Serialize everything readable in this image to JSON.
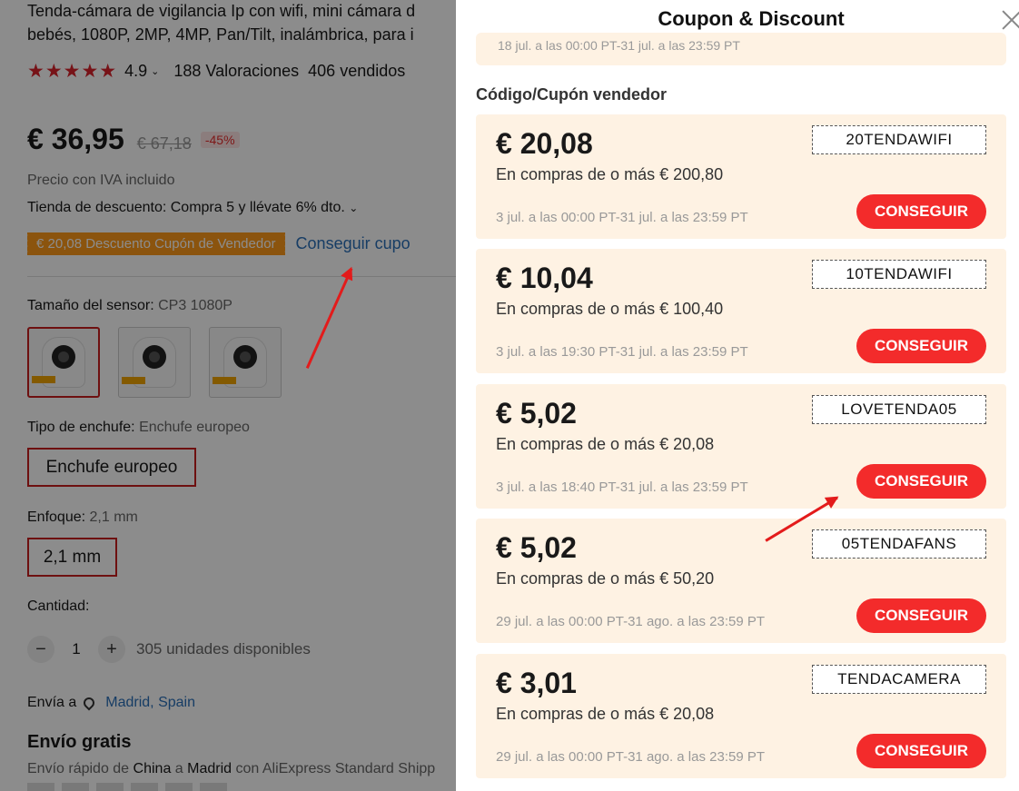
{
  "product": {
    "title_line1": "Tenda-cámara de vigilancia Ip con wifi, mini cámara d",
    "title_line2": "bebés, 1080P, 2MP, 4MP, Pan/Tilt, inalámbrica, para i",
    "stars": "★★★★★",
    "rating": "4.9",
    "reviews": "188 Valoraciones",
    "sold": "406 vendidos",
    "price": "€ 36,95",
    "old_price": "€ 67,18",
    "discount_pct": "-45%",
    "vat_note": "Precio con IVA incluido",
    "store_discount": "Tienda de descuento: Compra 5 y llévate 6% dto.",
    "coupon_tag": "€ 20,08 Descuento Cupón de Vendedor",
    "coupon_link": "Conseguir cupo",
    "sensor_label": "Tamaño del sensor:",
    "sensor_value": "CP3 1080P",
    "plug_label": "Tipo de enchufe:",
    "plug_value": "Enchufe europeo",
    "plug_option": "Enchufe europeo",
    "focus_label": "Enfoque:",
    "focus_value": "2,1 mm",
    "focus_option": "2,1 mm",
    "qty_label": "Cantidad:",
    "qty_minus": "−",
    "qty_value": "1",
    "qty_plus": "+",
    "qty_available": "305 unidades disponibles",
    "ship_to_label": "Envía a",
    "ship_to_location": "Madrid, Spain",
    "free_shipping": "Envío gratis",
    "ship_desc_1": "Envío rápido de ",
    "ship_origin": "China",
    "ship_desc_2": " a ",
    "ship_dest": "Madrid",
    "ship_desc_3": " con AliExpress Standard Shipp"
  },
  "panel": {
    "title": "Coupon & Discount",
    "prev_period": "18 jul. a las 00:00 PT-31 jul. a las 23:59 PT",
    "section_title": "Código/Cupón vendedor",
    "button_label": "CONSEGUIR",
    "coupons": [
      {
        "amount": "€ 20,08",
        "condition": "En compras de o más € 200,80",
        "period": "3 jul. a las 00:00 PT-31 jul. a las 23:59 PT",
        "code": "20TENDAWIFI"
      },
      {
        "amount": "€ 10,04",
        "condition": "En compras de o más € 100,40",
        "period": "3 jul. a las 19:30 PT-31 jul. a las 23:59 PT",
        "code": "10TENDAWIFI"
      },
      {
        "amount": "€ 5,02",
        "condition": "En compras de o más € 20,08",
        "period": "3 jul. a las 18:40 PT-31 jul. a las 23:59 PT",
        "code": "LOVETENDA05"
      },
      {
        "amount": "€ 5,02",
        "condition": "En compras de o más € 50,20",
        "period": "29 jul. a las 00:00 PT-31 ago. a las 23:59 PT",
        "code": "05TENDAFANS"
      },
      {
        "amount": "€ 3,01",
        "condition": "En compras de o más € 20,08",
        "period": "29 jul. a las 00:00 PT-31 ago. a las 23:59 PT",
        "code": "TENDACAMERA"
      }
    ]
  },
  "colors": {
    "accent_red": "#f32b2b",
    "card_bg": "#fef2e3",
    "coupon_tag": "#fd9a1a",
    "link_blue": "#2a6fb8"
  }
}
